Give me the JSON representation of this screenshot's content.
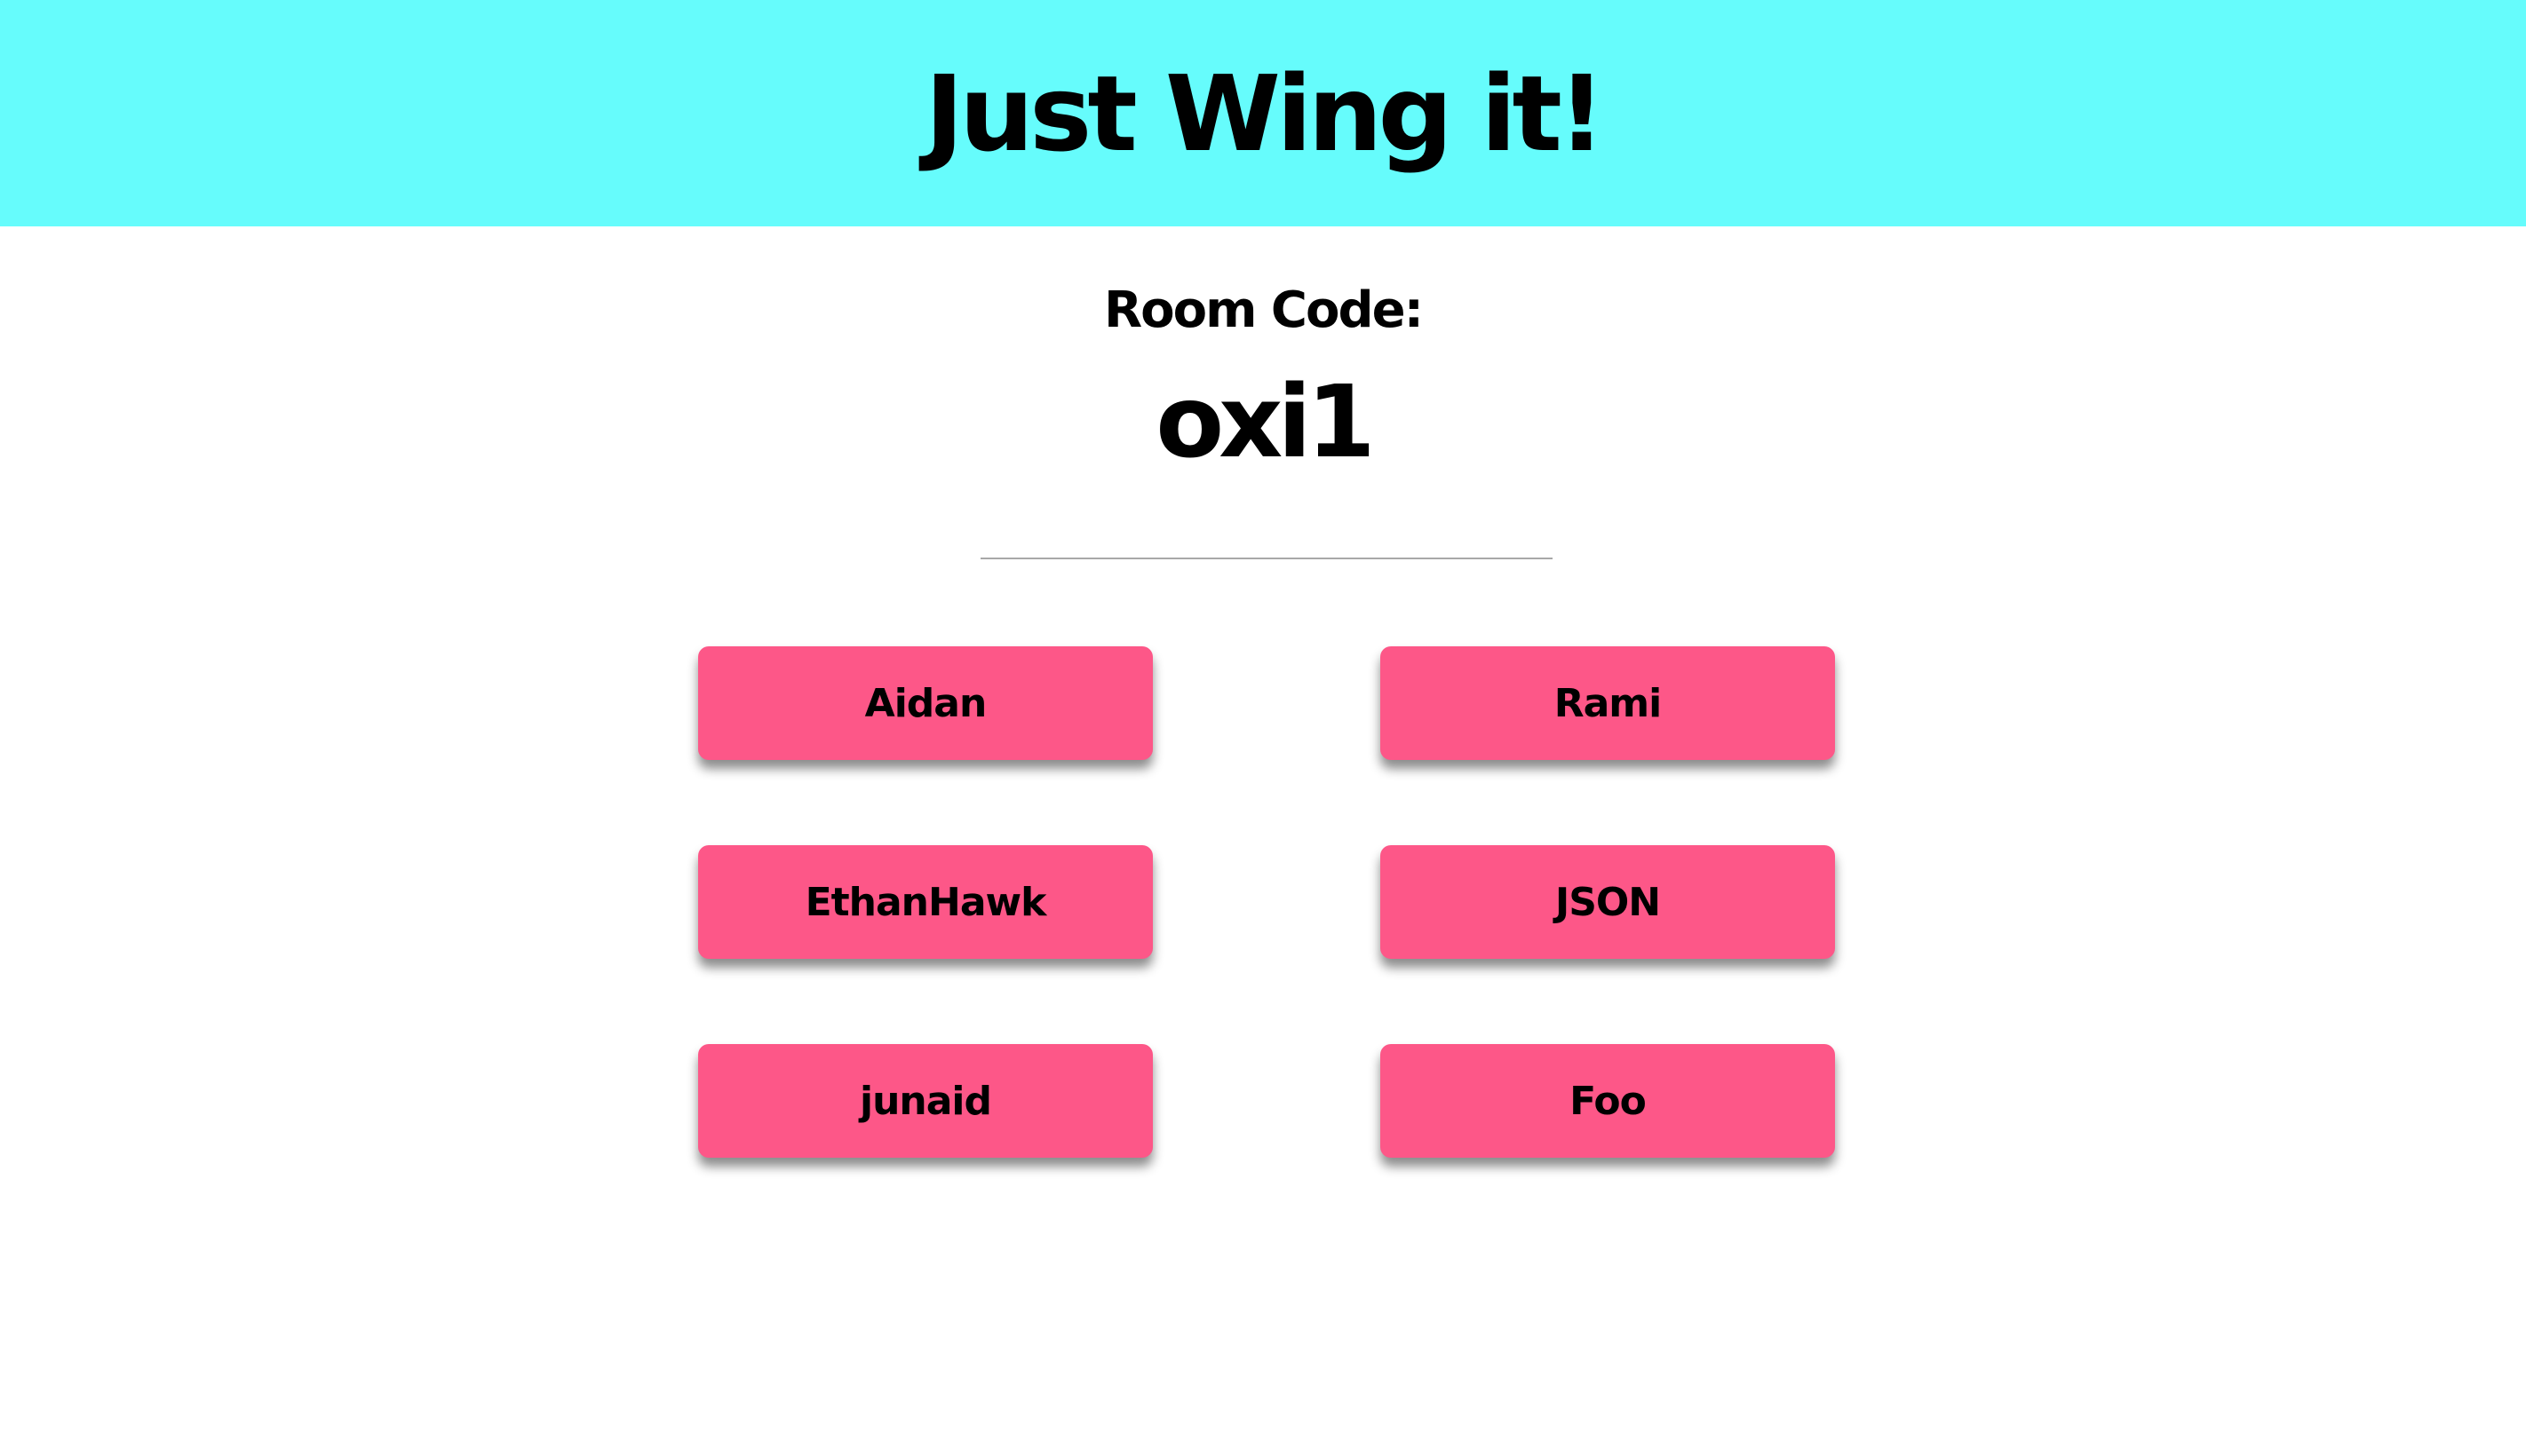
{
  "header": {
    "title": "Just Wing it!",
    "background_color": "#66fcfc"
  },
  "room": {
    "label": "Room Code:",
    "code": "oxi1"
  },
  "players": [
    {
      "name": "Aidan"
    },
    {
      "name": "Rami"
    },
    {
      "name": "EthanHawk"
    },
    {
      "name": "JSON"
    },
    {
      "name": "junaid"
    },
    {
      "name": "Foo"
    }
  ],
  "colors": {
    "player_button": "#fd5788",
    "text": "#000000",
    "divider": "#a8a8a8"
  }
}
